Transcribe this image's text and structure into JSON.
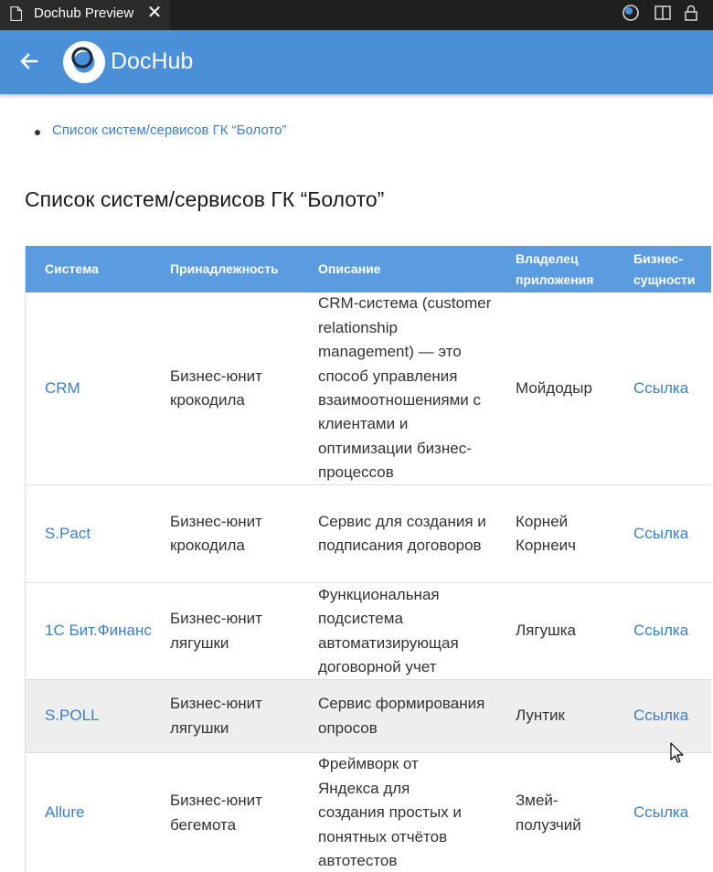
{
  "tabbar": {
    "tab_title": "Dochub Preview",
    "close_glyph": "✕",
    "icons": [
      "file-icon",
      "close-icon",
      "account-sync-icon",
      "split-editor-icon",
      "lock-icon"
    ]
  },
  "header": {
    "title": "DocHub",
    "background": "#4a90d9"
  },
  "toc": {
    "items": [
      {
        "label": "Список систем/сервисов ГК “Болото”"
      }
    ]
  },
  "page": {
    "heading": "Список систем/сервисов ГК “Болото”"
  },
  "table": {
    "columns": [
      "Система",
      "Принадлежность",
      "Описание",
      "Владелец приложения",
      "Бизнес-сущности"
    ],
    "header_color": "#5b9be0",
    "rows": [
      {
        "system": "CRM",
        "owner_unit": "Бизнес-юнит крокодила",
        "description": "CRM-система (customer relationship management) — это способ управления взаимоотношениями с клиентами и оптимизации бизнес-процессов",
        "owner": "Мойдодыр",
        "entities": "Ссылка"
      },
      {
        "system": "S.Pact",
        "owner_unit": "Бизнес-юнит крокодила",
        "description": "Сервис для создания и подписания договоров",
        "owner": "Корней Корнеич",
        "entities": "Ссылка"
      },
      {
        "system": "1С Бит.Финанс",
        "owner_unit": "Бизнес-юнит лягушки",
        "description": "Функциональная подсистема автоматизирующая договорной учет",
        "owner": "Лягушка",
        "entities": "Ссылка"
      },
      {
        "system": "S.POLL",
        "owner_unit": "Бизнес-юнит лягушки",
        "description": "Сервис формирования опросов",
        "owner": "Лунтик",
        "entities": "Ссылка"
      },
      {
        "system": "Allure",
        "owner_unit": "Бизнес-юнит бегемота",
        "description": "Фреймворк от Яндекса для создания простых и понятных отчётов автотестов",
        "owner": "Змей-полузчий",
        "entities": "Ссылка"
      }
    ]
  }
}
